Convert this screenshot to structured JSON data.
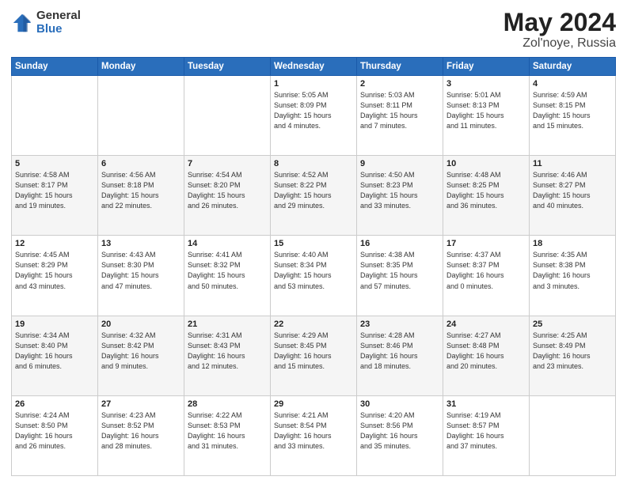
{
  "header": {
    "logo_general": "General",
    "logo_blue": "Blue",
    "title_month": "May 2024",
    "title_location": "Zol'noye, Russia"
  },
  "days_of_week": [
    "Sunday",
    "Monday",
    "Tuesday",
    "Wednesday",
    "Thursday",
    "Friday",
    "Saturday"
  ],
  "weeks": [
    [
      {
        "day": "",
        "info": ""
      },
      {
        "day": "",
        "info": ""
      },
      {
        "day": "",
        "info": ""
      },
      {
        "day": "1",
        "info": "Sunrise: 5:05 AM\nSunset: 8:09 PM\nDaylight: 15 hours\nand 4 minutes."
      },
      {
        "day": "2",
        "info": "Sunrise: 5:03 AM\nSunset: 8:11 PM\nDaylight: 15 hours\nand 7 minutes."
      },
      {
        "day": "3",
        "info": "Sunrise: 5:01 AM\nSunset: 8:13 PM\nDaylight: 15 hours\nand 11 minutes."
      },
      {
        "day": "4",
        "info": "Sunrise: 4:59 AM\nSunset: 8:15 PM\nDaylight: 15 hours\nand 15 minutes."
      }
    ],
    [
      {
        "day": "5",
        "info": "Sunrise: 4:58 AM\nSunset: 8:17 PM\nDaylight: 15 hours\nand 19 minutes."
      },
      {
        "day": "6",
        "info": "Sunrise: 4:56 AM\nSunset: 8:18 PM\nDaylight: 15 hours\nand 22 minutes."
      },
      {
        "day": "7",
        "info": "Sunrise: 4:54 AM\nSunset: 8:20 PM\nDaylight: 15 hours\nand 26 minutes."
      },
      {
        "day": "8",
        "info": "Sunrise: 4:52 AM\nSunset: 8:22 PM\nDaylight: 15 hours\nand 29 minutes."
      },
      {
        "day": "9",
        "info": "Sunrise: 4:50 AM\nSunset: 8:23 PM\nDaylight: 15 hours\nand 33 minutes."
      },
      {
        "day": "10",
        "info": "Sunrise: 4:48 AM\nSunset: 8:25 PM\nDaylight: 15 hours\nand 36 minutes."
      },
      {
        "day": "11",
        "info": "Sunrise: 4:46 AM\nSunset: 8:27 PM\nDaylight: 15 hours\nand 40 minutes."
      }
    ],
    [
      {
        "day": "12",
        "info": "Sunrise: 4:45 AM\nSunset: 8:29 PM\nDaylight: 15 hours\nand 43 minutes."
      },
      {
        "day": "13",
        "info": "Sunrise: 4:43 AM\nSunset: 8:30 PM\nDaylight: 15 hours\nand 47 minutes."
      },
      {
        "day": "14",
        "info": "Sunrise: 4:41 AM\nSunset: 8:32 PM\nDaylight: 15 hours\nand 50 minutes."
      },
      {
        "day": "15",
        "info": "Sunrise: 4:40 AM\nSunset: 8:34 PM\nDaylight: 15 hours\nand 53 minutes."
      },
      {
        "day": "16",
        "info": "Sunrise: 4:38 AM\nSunset: 8:35 PM\nDaylight: 15 hours\nand 57 minutes."
      },
      {
        "day": "17",
        "info": "Sunrise: 4:37 AM\nSunset: 8:37 PM\nDaylight: 16 hours\nand 0 minutes."
      },
      {
        "day": "18",
        "info": "Sunrise: 4:35 AM\nSunset: 8:38 PM\nDaylight: 16 hours\nand 3 minutes."
      }
    ],
    [
      {
        "day": "19",
        "info": "Sunrise: 4:34 AM\nSunset: 8:40 PM\nDaylight: 16 hours\nand 6 minutes."
      },
      {
        "day": "20",
        "info": "Sunrise: 4:32 AM\nSunset: 8:42 PM\nDaylight: 16 hours\nand 9 minutes."
      },
      {
        "day": "21",
        "info": "Sunrise: 4:31 AM\nSunset: 8:43 PM\nDaylight: 16 hours\nand 12 minutes."
      },
      {
        "day": "22",
        "info": "Sunrise: 4:29 AM\nSunset: 8:45 PM\nDaylight: 16 hours\nand 15 minutes."
      },
      {
        "day": "23",
        "info": "Sunrise: 4:28 AM\nSunset: 8:46 PM\nDaylight: 16 hours\nand 18 minutes."
      },
      {
        "day": "24",
        "info": "Sunrise: 4:27 AM\nSunset: 8:48 PM\nDaylight: 16 hours\nand 20 minutes."
      },
      {
        "day": "25",
        "info": "Sunrise: 4:25 AM\nSunset: 8:49 PM\nDaylight: 16 hours\nand 23 minutes."
      }
    ],
    [
      {
        "day": "26",
        "info": "Sunrise: 4:24 AM\nSunset: 8:50 PM\nDaylight: 16 hours\nand 26 minutes."
      },
      {
        "day": "27",
        "info": "Sunrise: 4:23 AM\nSunset: 8:52 PM\nDaylight: 16 hours\nand 28 minutes."
      },
      {
        "day": "28",
        "info": "Sunrise: 4:22 AM\nSunset: 8:53 PM\nDaylight: 16 hours\nand 31 minutes."
      },
      {
        "day": "29",
        "info": "Sunrise: 4:21 AM\nSunset: 8:54 PM\nDaylight: 16 hours\nand 33 minutes."
      },
      {
        "day": "30",
        "info": "Sunrise: 4:20 AM\nSunset: 8:56 PM\nDaylight: 16 hours\nand 35 minutes."
      },
      {
        "day": "31",
        "info": "Sunrise: 4:19 AM\nSunset: 8:57 PM\nDaylight: 16 hours\nand 37 minutes."
      },
      {
        "day": "",
        "info": ""
      }
    ]
  ]
}
